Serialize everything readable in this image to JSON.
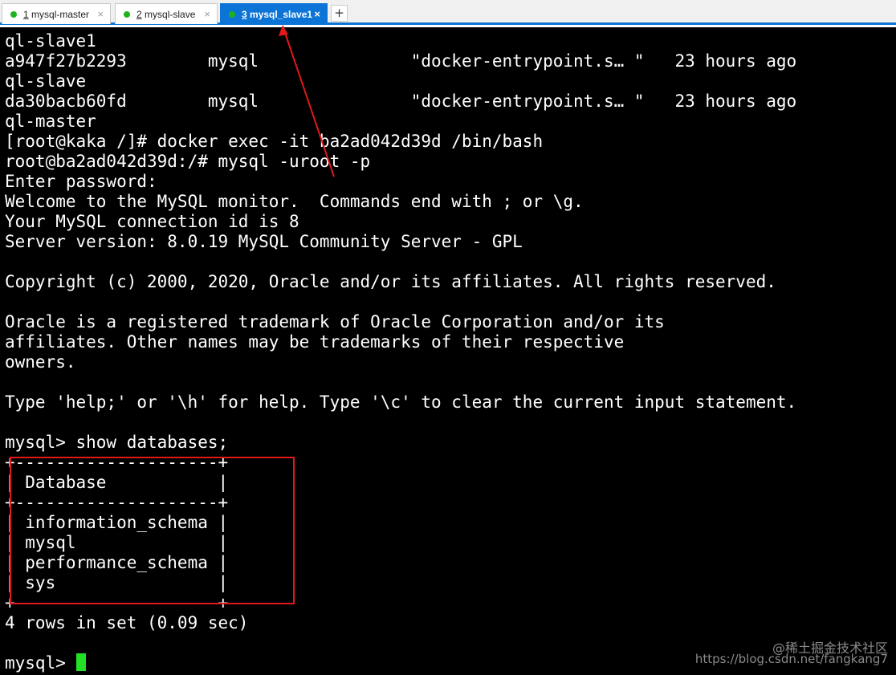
{
  "tabs": [
    {
      "number": "1",
      "title": " mysql-master",
      "close": "×",
      "active": false
    },
    {
      "number": "2",
      "title": " mysql-slave",
      "close": "×",
      "active": false
    },
    {
      "number": "3",
      "title": " mysql_slave1",
      "close": "×",
      "active": true
    }
  ],
  "new_tab_label": "+",
  "terminal": {
    "lines": [
      "ql-slave1",
      "a947f27b2293        mysql               \"docker-entrypoint.s… \"   23 hours ago",
      "ql-slave",
      "da30bacb60fd        mysql               \"docker-entrypoint.s… \"   23 hours ago",
      "ql-master",
      "[root@kaka /]# docker exec -it ba2ad042d39d /bin/bash",
      "root@ba2ad042d39d:/# mysql -uroot -p",
      "Enter password:",
      "Welcome to the MySQL monitor.  Commands end with ; or \\g.",
      "Your MySQL connection id is 8",
      "Server version: 8.0.19 MySQL Community Server - GPL",
      "",
      "Copyright (c) 2000, 2020, Oracle and/or its affiliates. All rights reserved.",
      "",
      "Oracle is a registered trademark of Oracle Corporation and/or its",
      "affiliates. Other names may be trademarks of their respective",
      "owners.",
      "",
      "Type 'help;' or '\\h' for help. Type '\\c' to clear the current input statement.",
      "",
      "mysql> show databases;",
      "+--------------------+",
      "| Database           |",
      "+--------------------+",
      "| information_schema |",
      "| mysql              |",
      "| performance_schema |",
      "| sys                |",
      "+--------------------+",
      "4 rows in set (0.09 sec)",
      ""
    ],
    "prompt": "mysql> "
  },
  "watermark": {
    "line1": "@稀土掘金技术社区",
    "line2": "https://blog.csdn.net/fangkang7"
  },
  "colors": {
    "terminal_bg": "#000000",
    "terminal_fg": "#ffffff",
    "cursor": "#22e022",
    "tab_active": "#0b74d6",
    "annotation": "#e0191b"
  }
}
